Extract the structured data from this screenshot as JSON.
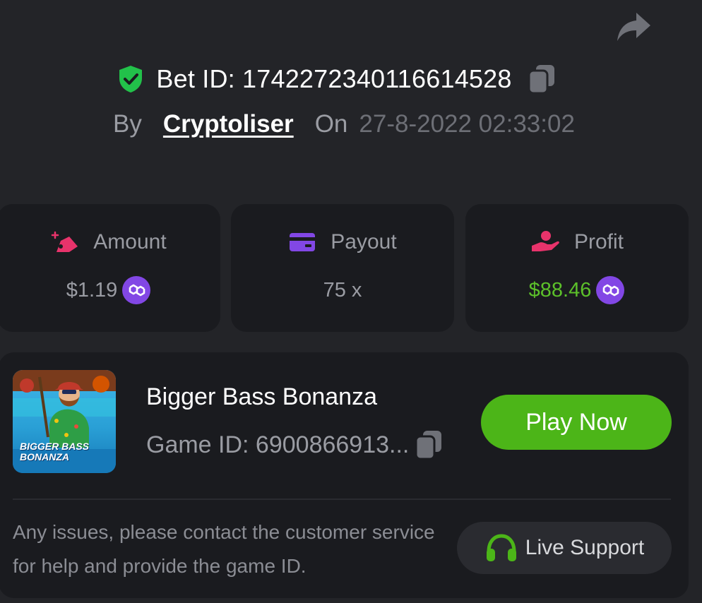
{
  "header": {
    "bet_id_label": "Bet ID: 1742272340116614528",
    "by_label": "By",
    "username": "Cryptoliser",
    "on_label": "On",
    "datetime": "27-8-2022 02:33:02"
  },
  "stats": {
    "amount": {
      "label": "Amount",
      "value": "$1.19",
      "icon": "amount-icon",
      "coin": "matic-coin-icon"
    },
    "payout": {
      "label": "Payout",
      "value": "75 x",
      "icon": "wallet-card-icon"
    },
    "profit": {
      "label": "Profit",
      "value": "$88.46",
      "icon": "profit-hand-icon",
      "coin": "matic-coin-icon"
    }
  },
  "game": {
    "title": "Bigger Bass Bonanza",
    "game_id": "Game ID: 6900866913...",
    "thumb_text_line1": "BIGGER BASS",
    "thumb_text_line2": "BONANZA",
    "play_label": "Play Now"
  },
  "support": {
    "help_text": "Any issues, please contact the customer service for help and provide the game ID.",
    "button_label": "Live Support"
  },
  "colors": {
    "background": "#232428",
    "card": "#1a1b1f",
    "accent_green": "#4cb518",
    "profit_green": "#5cc02a",
    "coin_purple": "#8247e5"
  }
}
